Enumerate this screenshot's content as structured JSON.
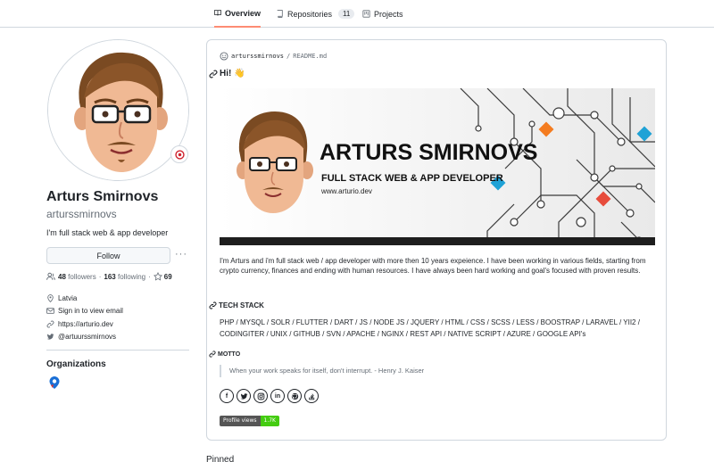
{
  "tabs": [
    {
      "label": "Overview",
      "icon": "book-icon",
      "active": true
    },
    {
      "label": "Repositories",
      "icon": "repo-icon",
      "count": "11"
    },
    {
      "label": "Projects",
      "icon": "project-icon"
    }
  ],
  "profile": {
    "full_name": "Arturs Smirnovs",
    "username": "arturssmirnovs",
    "bio": "I'm full stack web & app developer",
    "follow_label": "Follow",
    "more_label": "···",
    "followers_count": "48",
    "followers_label": "followers",
    "separator": "·",
    "following_count": "163",
    "following_label": "following",
    "stars_count": "69",
    "vcard": {
      "location": "Latvia",
      "email": "Sign in to view email",
      "website": "https://arturio.dev",
      "twitter": "@artuurssmirnovs"
    },
    "orgs_title": "Organizations"
  },
  "readme": {
    "owner": "arturssmirnovs",
    "slash": "/",
    "file": "README.md",
    "heading_hi": "Hi! 👋",
    "banner": {
      "name": "ARTURS SMIRNOVS",
      "title": "FULL STACK WEB & APP DEVELOPER",
      "url": "www.arturio.dev"
    },
    "intro": "I'm Arturs and i'm full stack web / app developer with more then 10 years expeience. I have been working in various fields, starting from crypto currency, finances and ending with human resources. I have always been hard working and goal's focused with proven results.",
    "tech_heading": "TECH STACK",
    "tech_list": "PHP / MYSQL / SOLR / FLUTTER / DART / JS / NODE JS / JQUERY / HTML / CSS / SCSS / LESS / BOOSTRAP / LARAVEL / YII2 / CODINGITER / UNIX / GITHUB / SVN / APACHE / NGINX / REST API / NATIVE SCRIPT / AZURE / GOOGLE API's",
    "motto_heading": "MOTTO",
    "motto": "When your work speaks for itself, don't interrupt. - Henry J. Kaiser",
    "socials": [
      "facebook-icon",
      "twitter-icon",
      "instagram-icon",
      "linkedin-icon",
      "github-icon",
      "stackoverflow-icon"
    ],
    "views_label": "Profile views",
    "views_count": "1.7K"
  },
  "pinned_label": "Pinned",
  "colors": {
    "accent_tab": "#fd8c73",
    "badge_green": "#44cc11",
    "banner_orange": "#f47c20",
    "banner_cyan": "#1fa2d6",
    "banner_red": "#e74c3c"
  }
}
